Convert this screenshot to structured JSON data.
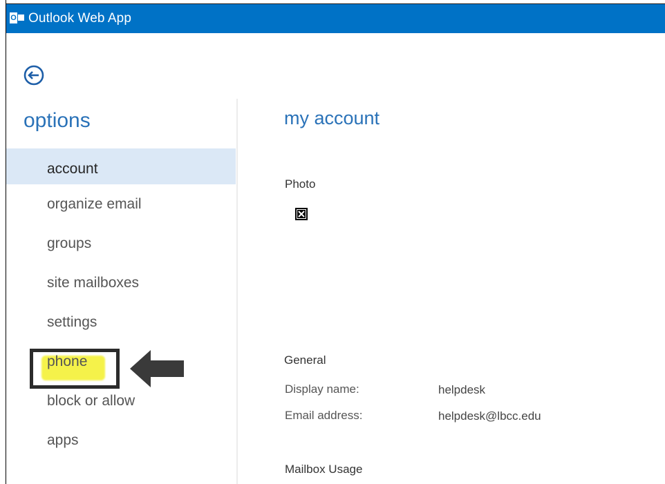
{
  "app": {
    "title": "Outlook Web App"
  },
  "sidebar": {
    "heading": "options",
    "items": [
      {
        "label": "account"
      },
      {
        "label": "organize email"
      },
      {
        "label": "groups"
      },
      {
        "label": "site mailboxes"
      },
      {
        "label": "settings"
      },
      {
        "label": "phone"
      },
      {
        "label": "block or allow"
      },
      {
        "label": "apps"
      }
    ],
    "selected": "account",
    "annotated": "phone"
  },
  "main": {
    "title": "my account",
    "photo_label": "Photo",
    "general": {
      "heading": "General",
      "display_name_label": "Display name:",
      "display_name_value": "helpdesk",
      "email_label": "Email address:",
      "email_value": "helpdesk@lbcc.edu"
    },
    "mailbox_usage_heading": "Mailbox Usage"
  },
  "colors": {
    "header_blue": "#0072c6",
    "accent_blue": "#2a72b8",
    "selected_bg": "#dbe8f6",
    "highlighter": "#f5f24a"
  },
  "icons": {
    "back": "back-arrow-circle-icon",
    "photo": "broken-image-icon",
    "logo": "outlook-logo-icon",
    "annotation": "left-arrow-icon"
  }
}
